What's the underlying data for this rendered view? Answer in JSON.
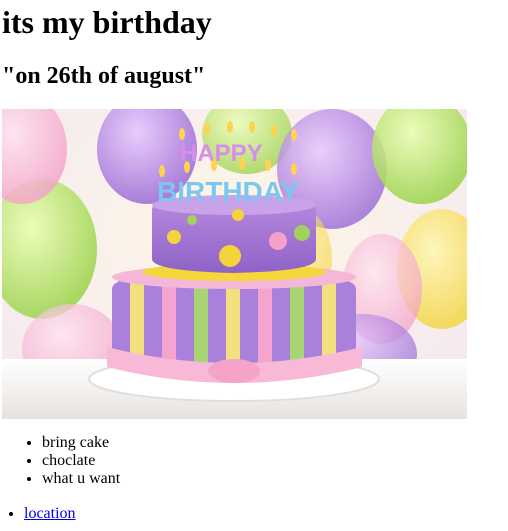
{
  "heading": "its my birthday",
  "subheading": "\"on 26th of august\"",
  "image": {
    "description_icon": "birthday-cake-photo",
    "cake_text_top": "HAPPY",
    "cake_text_bottom": "BIRTHDAY"
  },
  "list_items": [
    "bring cake",
    "choclate",
    "what u want"
  ],
  "links": [
    "location"
  ]
}
